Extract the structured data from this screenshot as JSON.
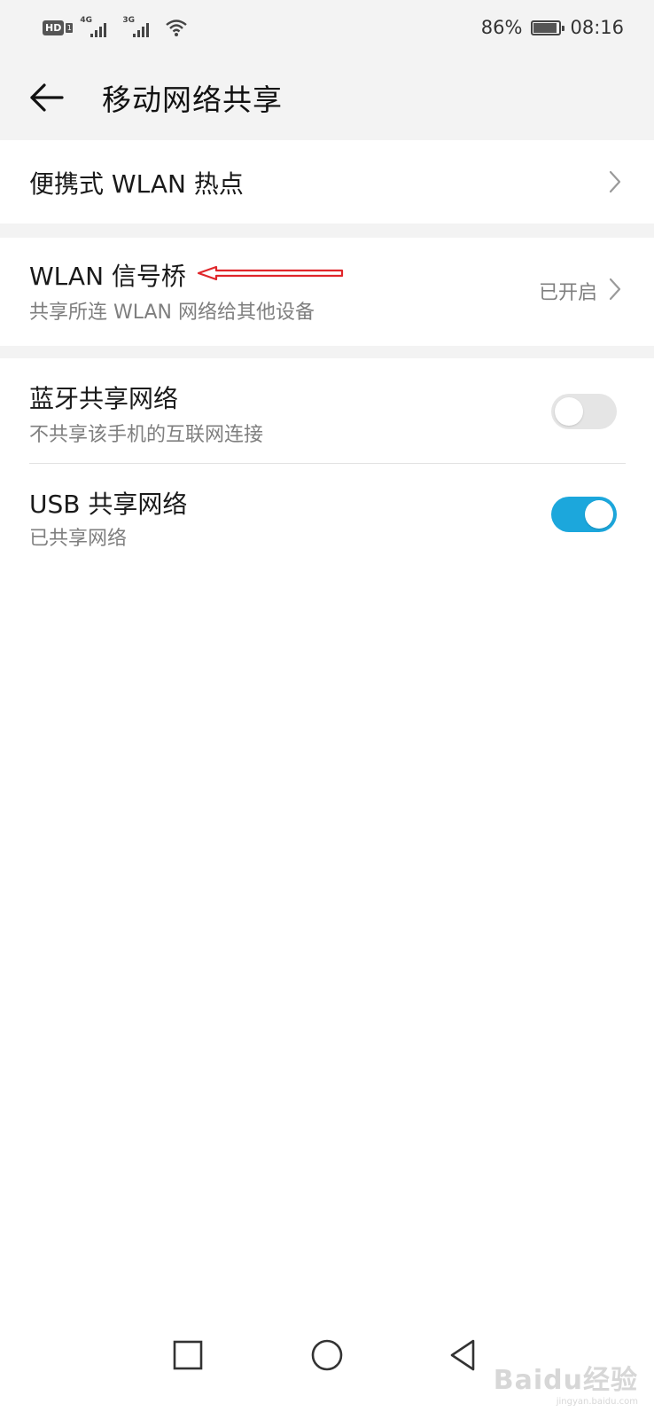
{
  "status_bar": {
    "hd_label": "HD",
    "hd_sub": "1",
    "signal1_tag": "4G",
    "signal2_tag": "3G",
    "battery_percent": "86%",
    "time": "08:16"
  },
  "header": {
    "title": "移动网络共享",
    "back_icon": "arrow-left-icon"
  },
  "items": [
    {
      "title": "便携式 WLAN 热点",
      "icon": "chevron-right-icon"
    },
    {
      "title": "WLAN 信号桥",
      "subtitle": "共享所连 WLAN 网络给其他设备",
      "status": "已开启",
      "icon": "chevron-right-icon"
    },
    {
      "title": "蓝牙共享网络",
      "subtitle": "不共享该手机的互联网连接",
      "toggle_on": false
    },
    {
      "title": "USB 共享网络",
      "subtitle": "已共享网络",
      "toggle_on": true
    }
  ],
  "annotation": {
    "color": "#e0262a"
  },
  "nav": {
    "recent_icon": "square-icon",
    "home_icon": "circle-icon",
    "back_icon": "triangle-back-icon"
  },
  "watermark": {
    "text": "Baidu经验",
    "sub": "jingyan.baidu.com"
  },
  "colors": {
    "accent": "#1ca7dc",
    "background": "#f3f3f3"
  }
}
